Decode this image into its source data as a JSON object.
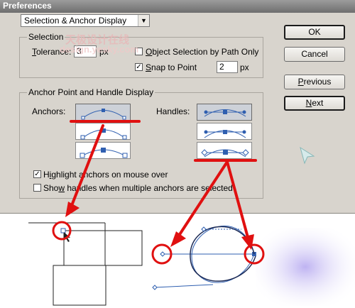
{
  "window": {
    "title": "Preferences"
  },
  "section_select": {
    "value": "Selection & Anchor Display"
  },
  "selection_group": {
    "legend": "Selection",
    "tolerance_label": "Tolerance:",
    "tolerance_value": "3",
    "tolerance_unit": "px",
    "object_selection_label": "Object Selection by Path Only",
    "object_selection_checked": false,
    "snap_label": "Snap to Point",
    "snap_checked": true,
    "snap_value": "2",
    "snap_unit": "px"
  },
  "anchor_group": {
    "legend": "Anchor Point and Handle Display",
    "anchors_label": "Anchors:",
    "handles_label": "Handles:",
    "highlight_label": "Highlight anchors on mouse over",
    "highlight_checked": true,
    "show_handles_label": "Show handles when multiple anchors are selected",
    "show_handles_checked": false
  },
  "buttons": {
    "ok": "OK",
    "cancel": "Cancel",
    "previous": "Previous",
    "next": "Next"
  },
  "watermark": {
    "cn": "天极设计在线",
    "url": "design.yesky.com"
  },
  "colors": {
    "annotation_red": "#e01010",
    "anchor_blue": "#2f5fb0",
    "dialog_bg": "#d8d4cd"
  }
}
